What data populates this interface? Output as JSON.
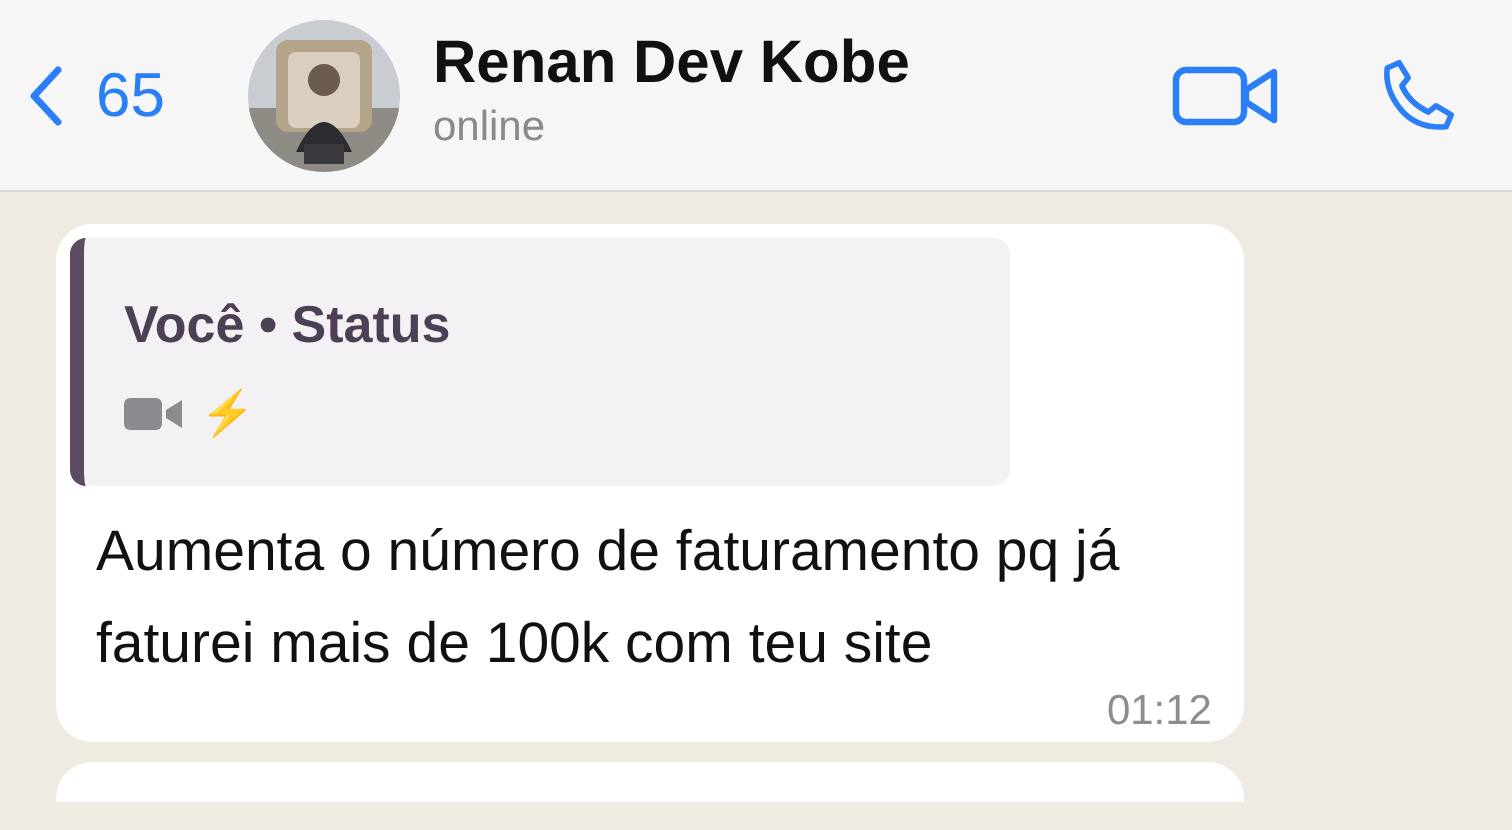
{
  "header": {
    "back_count": "65",
    "contact_name": "Renan Dev Kobe",
    "presence": "online"
  },
  "messages": [
    {
      "kind": "received",
      "quote": {
        "author": "Você • Status",
        "emoji": "⚡"
      },
      "text": "Aumenta o número de faturamento pq já faturei mais de 100k com teu site",
      "time": "01:12"
    }
  ]
}
